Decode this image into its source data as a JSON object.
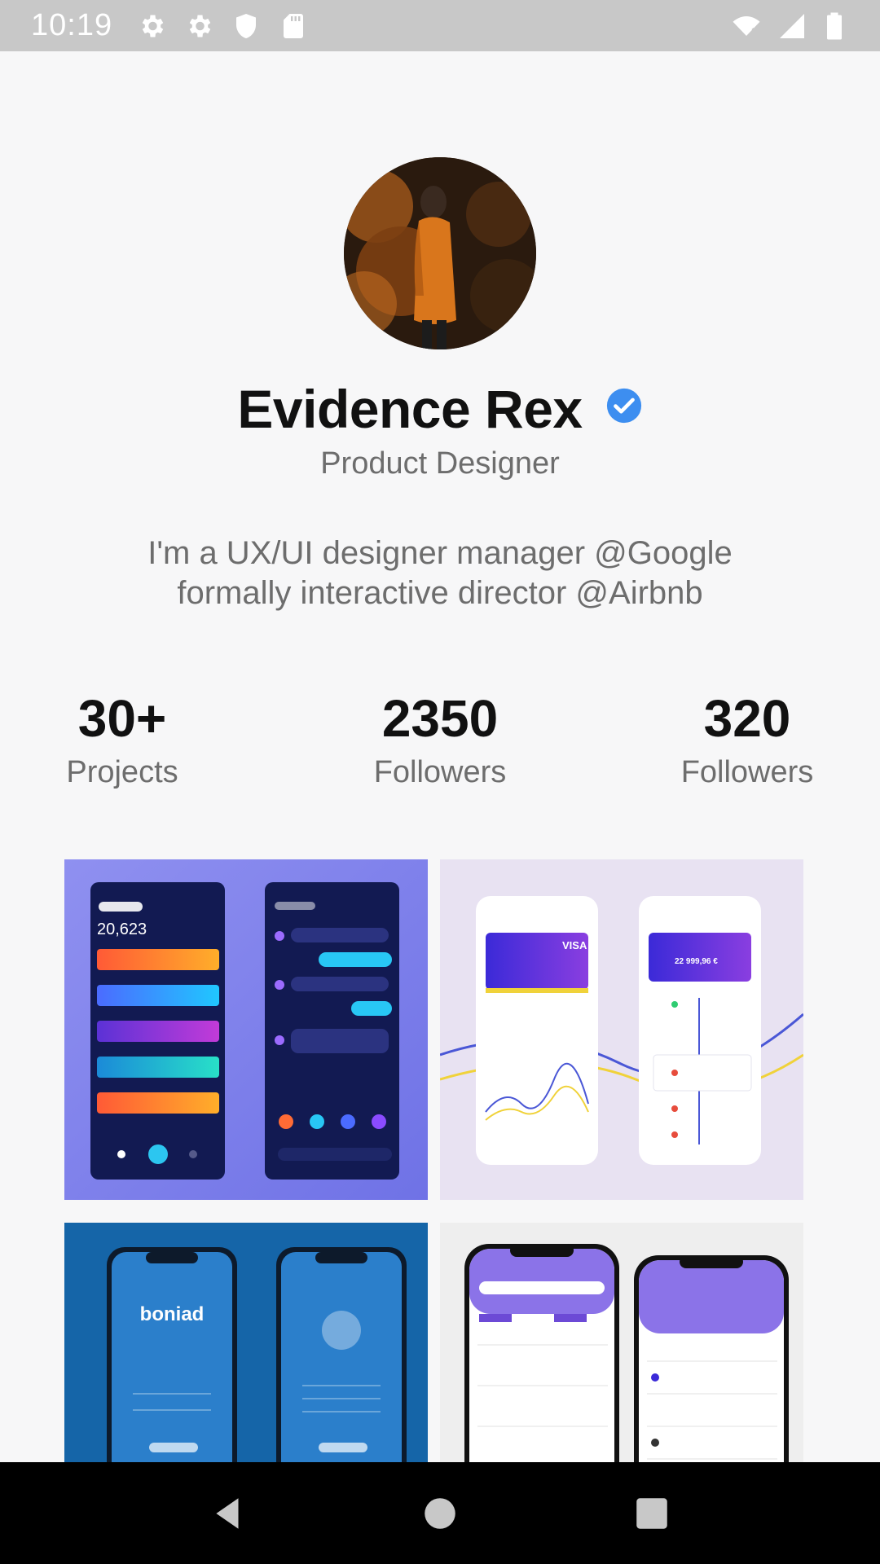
{
  "status_bar": {
    "time": "10:19",
    "left_icons": [
      "settings-icon",
      "settings-icon",
      "shield-icon",
      "sd-card-icon"
    ],
    "right_icons": [
      "wifi-icon",
      "cellular-signal-icon",
      "battery-icon"
    ]
  },
  "profile": {
    "name": "Evidence Rex",
    "role": "Product Designer",
    "bio_line_1": "I'm a UX/UI designer manager @Google",
    "bio_line_2": "formally interactive director @Airbnb",
    "verified_color": "#3d8ef0"
  },
  "stats": [
    {
      "value": "30+",
      "label": "Projects"
    },
    {
      "value": "2350",
      "label": "Followers"
    },
    {
      "value": "320",
      "label": "Followers"
    }
  ],
  "gallery": {
    "tiles": [
      {
        "name": "wallet-app-shot",
        "balance": "20,623"
      },
      {
        "name": "card-finance-shot",
        "card_brand": "VISA",
        "amount": "22 999,96 €"
      },
      {
        "name": "boniad-app-shot",
        "brand": "boniad"
      },
      {
        "name": "flight-search-shot"
      }
    ]
  },
  "nav": [
    "back-icon",
    "home-icon",
    "recents-icon"
  ]
}
